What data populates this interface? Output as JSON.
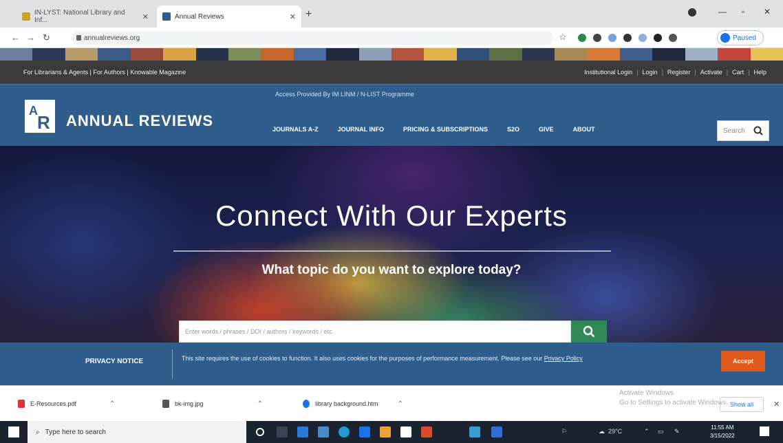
{
  "browser": {
    "tabs": [
      {
        "title": "IN-LYST: National Library and Inf...",
        "active": false
      },
      {
        "title": "Annual Reviews",
        "active": true
      }
    ],
    "new_tab": "+",
    "url": "annualreviews.org",
    "signin_label": "Paused"
  },
  "site": {
    "util_left": "For Librarians & Agents | For Authors | Knowable Magazine",
    "util_right": [
      "Institutional Login",
      "Login",
      "Register",
      "Activate",
      "Cart",
      "Help"
    ],
    "logo_text": "ANNUAL REVIEWS",
    "access_text": "Access Provided By IM LINM / N-LIST Programme",
    "nav": [
      "JOURNALS A-Z",
      "JOURNAL INFO",
      "PRICING & SUBSCRIPTIONS",
      "S2O",
      "GIVE",
      "ABOUT"
    ],
    "search_placeholder": "Search",
    "hero_title": "Connect With Our Experts",
    "hero_subtitle": "What topic do you want to explore today?",
    "hero_search_placeholder": "Enter words / phrases / DOI / authors / keywords / etc.",
    "privacy_label": "PRIVACY NOTICE",
    "privacy_text": "This site requires the use of cookies to function. It also uses cookies for the purposes of performance measurement. Please see our",
    "privacy_link": "Privacy Policy",
    "accept_label": "Accept"
  },
  "downloads": {
    "items": [
      {
        "name": "E-Resources.pdf"
      },
      {
        "name": "bk-img.jpg"
      },
      {
        "name": "library background.htm"
      }
    ],
    "show_all": "Show all",
    "activate_line1": "Activate Windows",
    "activate_line2": "Go to Settings to activate Windows."
  },
  "taskbar": {
    "search_placeholder": "Type here to search",
    "temperature": "29°C",
    "time": "11:55 AM",
    "date": "3/15/2022"
  },
  "colors": {
    "site_blue": "#2f5d8c",
    "accept_orange": "#e05a1b",
    "search_green": "#2f8a55"
  }
}
